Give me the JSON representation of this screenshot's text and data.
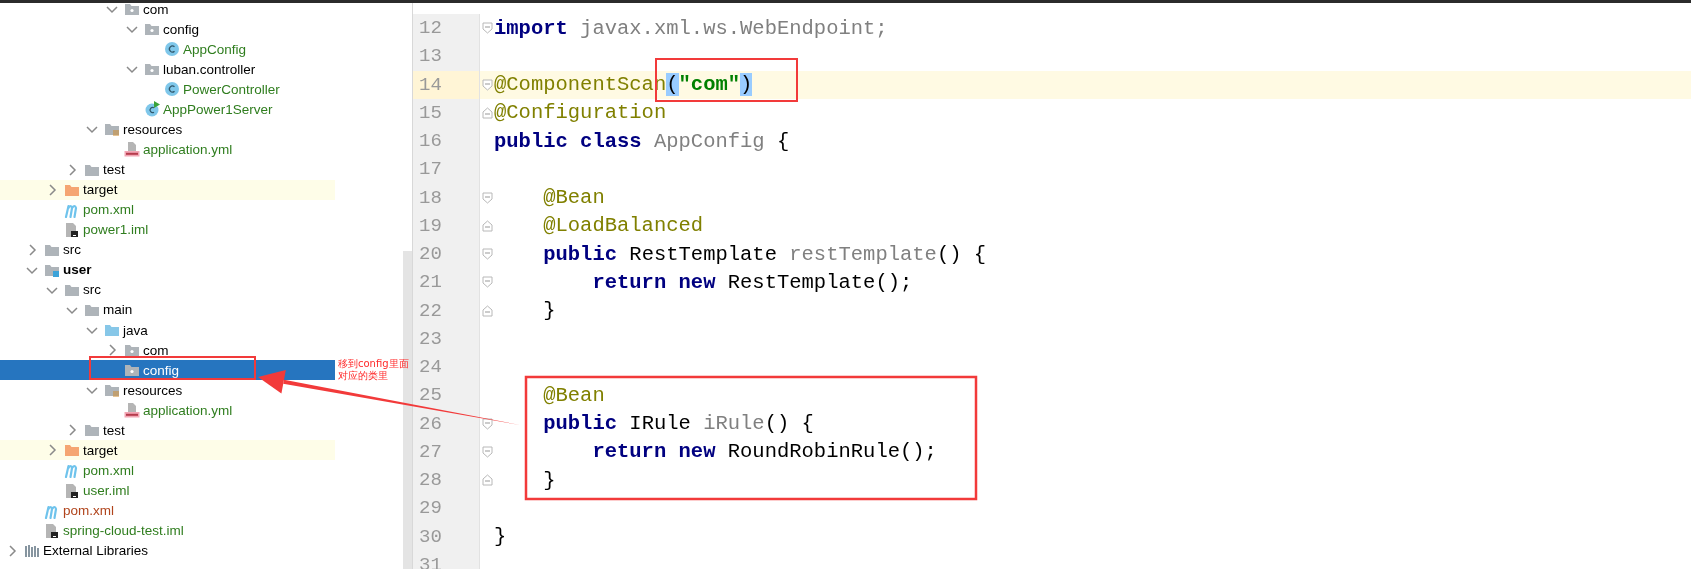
{
  "project_tree": {
    "items": [
      {
        "children": [
          {
            "children": [
              {
                "children": [
                  {
                    "children": [
                      {
                        "children": [
                          {
                            "label": "com",
                            "kind": "package",
                            "expanded": true,
                            "selected": false,
                            "highlighted": false,
                            "children": [
                              {
                                "label": "config",
                                "kind": "package",
                                "expanded": true,
                                "selected": false,
                                "highlighted": false,
                                "children": [
                                  {
                                    "label": "AppConfig",
                                    "kind": "class",
                                    "selected": false,
                                    "highlighted": false,
                                    "color": "#2f7d1e"
                                  }
                                ]
                              },
                              {
                                "label": "luban.controller",
                                "kind": "package",
                                "expanded": true,
                                "selected": false,
                                "highlighted": false,
                                "children": [
                                  {
                                    "label": "PowerController",
                                    "kind": "class",
                                    "selected": false,
                                    "highlighted": false,
                                    "color": "#2f7d1e"
                                  }
                                ]
                              },
                              {
                                "label": "AppPower1Server",
                                "kind": "main-class",
                                "selected": false,
                                "highlighted": false,
                                "color": "#2f7d1e"
                              }
                            ]
                          }
                        ]
                      },
                      {
                        "label": "resources",
                        "kind": "resources-root",
                        "expanded": true,
                        "selected": false,
                        "highlighted": false,
                        "children": [
                          {
                            "label": "application.yml",
                            "kind": "yml",
                            "selected": false,
                            "highlighted": false,
                            "color": "#2f7d1e"
                          }
                        ]
                      }
                    ]
                  },
                  {
                    "label": "test",
                    "kind": "folder",
                    "expanded": false,
                    "selected": false,
                    "highlighted": false
                  }
                ]
              },
              {
                "label": "target",
                "kind": "excluded",
                "expanded": false,
                "selected": false,
                "highlighted": true
              },
              {
                "label": "pom.xml",
                "kind": "maven",
                "selected": false,
                "highlighted": false,
                "color": "#2f7d1e"
              },
              {
                "label": "power1.iml",
                "kind": "iml",
                "selected": false,
                "highlighted": false,
                "color": "#2f7d1e"
              }
            ]
          },
          {
            "label": "src",
            "kind": "folder",
            "expanded": false,
            "selected": false,
            "highlighted": false
          },
          {
            "label": "user",
            "kind": "module",
            "expanded": true,
            "selected": false,
            "highlighted": false,
            "children": [
              {
                "label": "src",
                "kind": "folder",
                "expanded": true,
                "selected": false,
                "highlighted": false,
                "children": [
                  {
                    "label": "main",
                    "kind": "folder",
                    "expanded": true,
                    "selected": false,
                    "highlighted": false,
                    "children": [
                      {
                        "label": "java",
                        "kind": "source-root",
                        "expanded": true,
                        "selected": false,
                        "highlighted": false,
                        "children": [
                          {
                            "label": "com",
                            "kind": "package",
                            "expanded": false,
                            "selected": false,
                            "highlighted": false
                          },
                          {
                            "label": "config",
                            "kind": "package",
                            "selected": true,
                            "highlighted": false
                          }
                        ]
                      },
                      {
                        "label": "resources",
                        "kind": "resources-root",
                        "expanded": true,
                        "selected": false,
                        "highlighted": false,
                        "children": [
                          {
                            "label": "application.yml",
                            "kind": "yml",
                            "selected": false,
                            "highlighted": false,
                            "color": "#2f7d1e"
                          }
                        ]
                      }
                    ]
                  },
                  {
                    "label": "test",
                    "kind": "folder",
                    "expanded": false,
                    "selected": false,
                    "highlighted": false
                  }
                ]
              },
              {
                "label": "target",
                "kind": "excluded",
                "expanded": false,
                "selected": false,
                "highlighted": true
              },
              {
                "label": "pom.xml",
                "kind": "maven",
                "selected": false,
                "highlighted": false,
                "color": "#2f7d1e"
              },
              {
                "label": "user.iml",
                "kind": "iml",
                "selected": false,
                "highlighted": false,
                "color": "#2f7d1e"
              }
            ]
          },
          {
            "label": "pom.xml",
            "kind": "maven",
            "selected": false,
            "highlighted": false,
            "color": "#b0441c"
          },
          {
            "label": "spring-cloud-test.iml",
            "kind": "iml",
            "selected": false,
            "highlighted": false,
            "color": "#2f7d1e"
          }
        ]
      },
      {
        "label": "External Libraries",
        "kind": "libraries",
        "expanded": false,
        "selected": false,
        "highlighted": false
      }
    ]
  },
  "editor": {
    "lines": [
      {
        "number": "12",
        "highlighted": false,
        "kind": "fold-start",
        "tokens": [
          {
            "kind": "keyword",
            "text": "import"
          },
          {
            "kind": "unused",
            "text": " javax.xml.ws.WebEndpoint;"
          }
        ]
      },
      {
        "number": "13",
        "highlighted": false,
        "kind": "plain"
      },
      {
        "number": "14",
        "highlighted": true,
        "kind": "fold-start",
        "tokens": [
          {
            "kind": "annotation",
            "text": "@ComponentScan"
          },
          {
            "kind": "brace-match",
            "text": "("
          },
          {
            "kind": "string",
            "text": "\"com\""
          },
          {
            "kind": "brace-match",
            "text": ")"
          }
        ]
      },
      {
        "number": "15",
        "highlighted": false,
        "kind": "fold-end",
        "tokens": [
          {
            "kind": "annotation",
            "text": "@Configuration"
          }
        ]
      },
      {
        "number": "16",
        "highlighted": false,
        "kind": "plain",
        "tokens": [
          {
            "kind": "keyword",
            "text": "public"
          },
          {
            "kind": "keyword",
            "text": " class"
          },
          {
            "kind": "unused",
            "text": " AppConfig"
          },
          {
            "kind": "plain",
            "text": " {"
          }
        ]
      },
      {
        "number": "17",
        "highlighted": false,
        "kind": "plain"
      },
      {
        "number": "18",
        "highlighted": false,
        "kind": "fold-start",
        "tokens": [
          {
            "kind": "annotation",
            "text": "    @Bean"
          }
        ]
      },
      {
        "number": "19",
        "highlighted": false,
        "kind": "fold-end",
        "tokens": [
          {
            "kind": "annotation",
            "text": "    @LoadBalanced"
          }
        ]
      },
      {
        "number": "20",
        "highlighted": false,
        "kind": "fold-start",
        "tokens": [
          {
            "kind": "keyword",
            "text": "    public"
          },
          {
            "kind": "plain",
            "text": " RestTemplate "
          },
          {
            "kind": "unused",
            "text": "restTemplate"
          },
          {
            "kind": "plain",
            "text": "() {"
          }
        ]
      },
      {
        "number": "21",
        "highlighted": false,
        "kind": "fold-start",
        "tokens": [
          {
            "kind": "keyword",
            "text": "        return"
          },
          {
            "kind": "keyword",
            "text": " new"
          },
          {
            "kind": "plain",
            "text": " RestTemplate();"
          }
        ]
      },
      {
        "number": "22",
        "highlighted": false,
        "kind": "fold-end",
        "tokens": [
          {
            "kind": "plain",
            "text": "    }"
          }
        ]
      },
      {
        "number": "23",
        "highlighted": false,
        "kind": "plain"
      },
      {
        "number": "24",
        "highlighted": false,
        "kind": "plain"
      },
      {
        "number": "25",
        "highlighted": false,
        "kind": "plain",
        "tokens": [
          {
            "kind": "annotation",
            "text": "    @Bean"
          }
        ]
      },
      {
        "number": "26",
        "highlighted": false,
        "kind": "fold-start",
        "tokens": [
          {
            "kind": "keyword",
            "text": "    public"
          },
          {
            "kind": "plain",
            "text": " IRule "
          },
          {
            "kind": "unused",
            "text": "iRule"
          },
          {
            "kind": "plain",
            "text": "() {"
          }
        ]
      },
      {
        "number": "27",
        "highlighted": false,
        "kind": "fold-start",
        "tokens": [
          {
            "kind": "keyword",
            "text": "        return"
          },
          {
            "kind": "keyword",
            "text": " new"
          },
          {
            "kind": "plain",
            "text": " RoundRobinRule();"
          }
        ]
      },
      {
        "number": "28",
        "highlighted": false,
        "kind": "fold-end",
        "tokens": [
          {
            "kind": "plain",
            "text": "    }"
          }
        ]
      },
      {
        "number": "29",
        "highlighted": false,
        "kind": "plain"
      },
      {
        "number": "30",
        "highlighted": false,
        "kind": "plain",
        "tokens": [
          {
            "kind": "plain",
            "text": "}"
          }
        ]
      },
      {
        "number": "31",
        "highlighted": false,
        "kind": "plain"
      }
    ]
  },
  "annotation": {
    "note": "移到config里面对应的类里"
  }
}
